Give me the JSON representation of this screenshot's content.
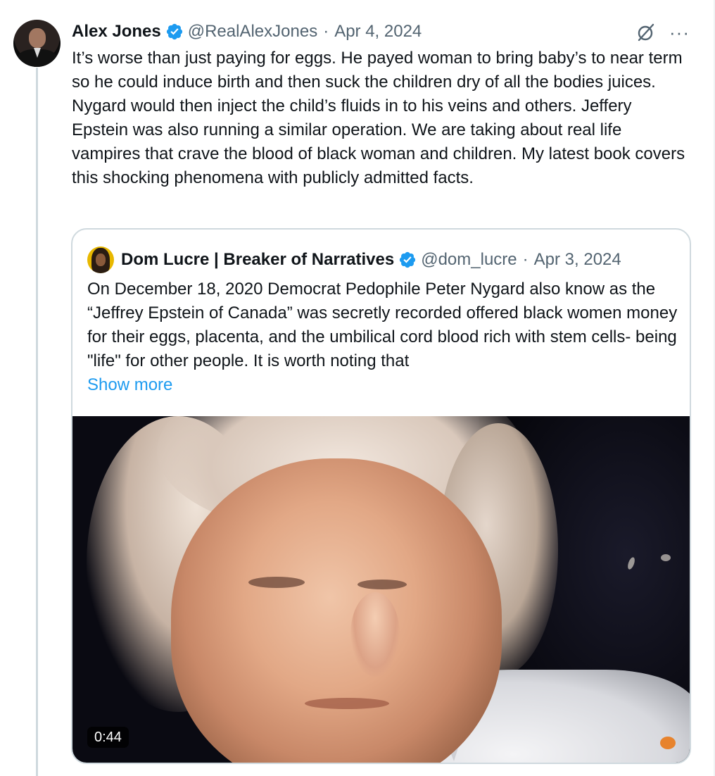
{
  "tweet": {
    "author_name": "Alex Jones",
    "handle": "@RealAlexJones",
    "separator": "·",
    "date": "Apr 4, 2024",
    "more_icon": "···",
    "text": "It’s worse than just paying for eggs. He payed woman to bring baby’s to near term so he could induce birth and then suck the children dry of all the bodies juices. Nygard would then inject the child’s fluids in to his veins and others. Jeffery Epstein was also running a similar operation. We are taking about real life vampires that crave the blood of black woman and children. My latest book covers this shocking phenomena with publicly admitted facts."
  },
  "quote": {
    "author_name": "Dom Lucre | Breaker of Narratives",
    "handle": "@dom_lucre",
    "separator": "·",
    "date": "Apr 3, 2024",
    "text": "On December 18, 2020 Democrat Pedophile Peter Nygard also know as the “Jeffrey Epstein of Canada” was secretly recorded offered black women money for their eggs, placenta, and the umbilical cord blood rich with stem cells- being \"life\" for other people. It is worth noting that",
    "show_more": "Show more",
    "video_duration": "0:44"
  },
  "icons": {
    "verified": "verified-badge-icon",
    "grok": "grok-icon",
    "more": "more-options-icon"
  },
  "colors": {
    "verified_blue": "#1d9bf0",
    "link_blue": "#1d9bf0",
    "secondary_text": "#536471",
    "border": "#cfd9de"
  }
}
